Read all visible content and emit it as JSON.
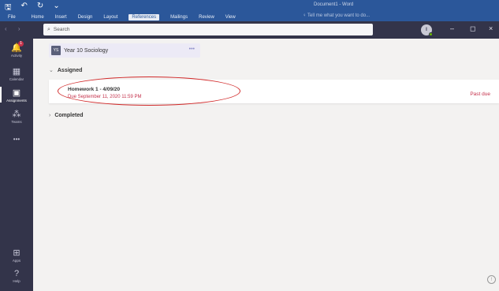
{
  "word": {
    "quick_access": [
      "🖫",
      "↶",
      "↻",
      "⌄"
    ],
    "doc_title": "Document1 - Word",
    "menu": [
      {
        "label": "File"
      },
      {
        "label": "Home"
      },
      {
        "label": "Insert"
      },
      {
        "label": "Design"
      },
      {
        "label": "Layout"
      },
      {
        "label": "References",
        "active": true
      },
      {
        "label": "Mailings"
      },
      {
        "label": "Review"
      },
      {
        "label": "View"
      }
    ],
    "tell_me": "♀ Tell me what you want to do..."
  },
  "teams": {
    "nav_back": "‹",
    "nav_forward": "›",
    "search_placeholder": "Search",
    "search_icon": "⌕",
    "avatar_initials": "I",
    "window_buttons": {
      "minimize": "–",
      "maximize": "◻",
      "close": "×"
    }
  },
  "rail": {
    "items": [
      {
        "id": "activity",
        "label": "Activity",
        "icon": "bell-icon",
        "glyph": "🔔",
        "badge": "1"
      },
      {
        "id": "calendar",
        "label": "Calendar",
        "icon": "calendar-icon",
        "glyph": "▦"
      },
      {
        "id": "assignments",
        "label": "Assignments",
        "icon": "assignments-icon",
        "glyph": "▣",
        "active": true
      },
      {
        "id": "teams",
        "label": "Teams",
        "icon": "teams-icon",
        "glyph": "⁂"
      },
      {
        "id": "more",
        "label": "",
        "icon": "more-icon",
        "glyph": "•••"
      }
    ],
    "bottom": [
      {
        "id": "apps",
        "label": "Apps",
        "icon": "apps-icon",
        "glyph": "⊞"
      },
      {
        "id": "help",
        "label": "Help",
        "icon": "help-icon",
        "glyph": "?"
      }
    ]
  },
  "main": {
    "class": {
      "chip": "YS",
      "name": "Year 10 Sociology",
      "more": "•••"
    },
    "assigned_heading": "Assigned",
    "completed_heading": "Completed",
    "assignment": {
      "title": "Homework 1 - 4/09/20",
      "due": "Due September 11, 2020 11:59 PM",
      "status": "Past due"
    },
    "feedback_glyph": "!"
  },
  "colors": {
    "word_blue": "#2b579a",
    "teams_dark": "#33344a",
    "past_due_red": "#c4314b",
    "annotation_red": "#d12a2a"
  }
}
